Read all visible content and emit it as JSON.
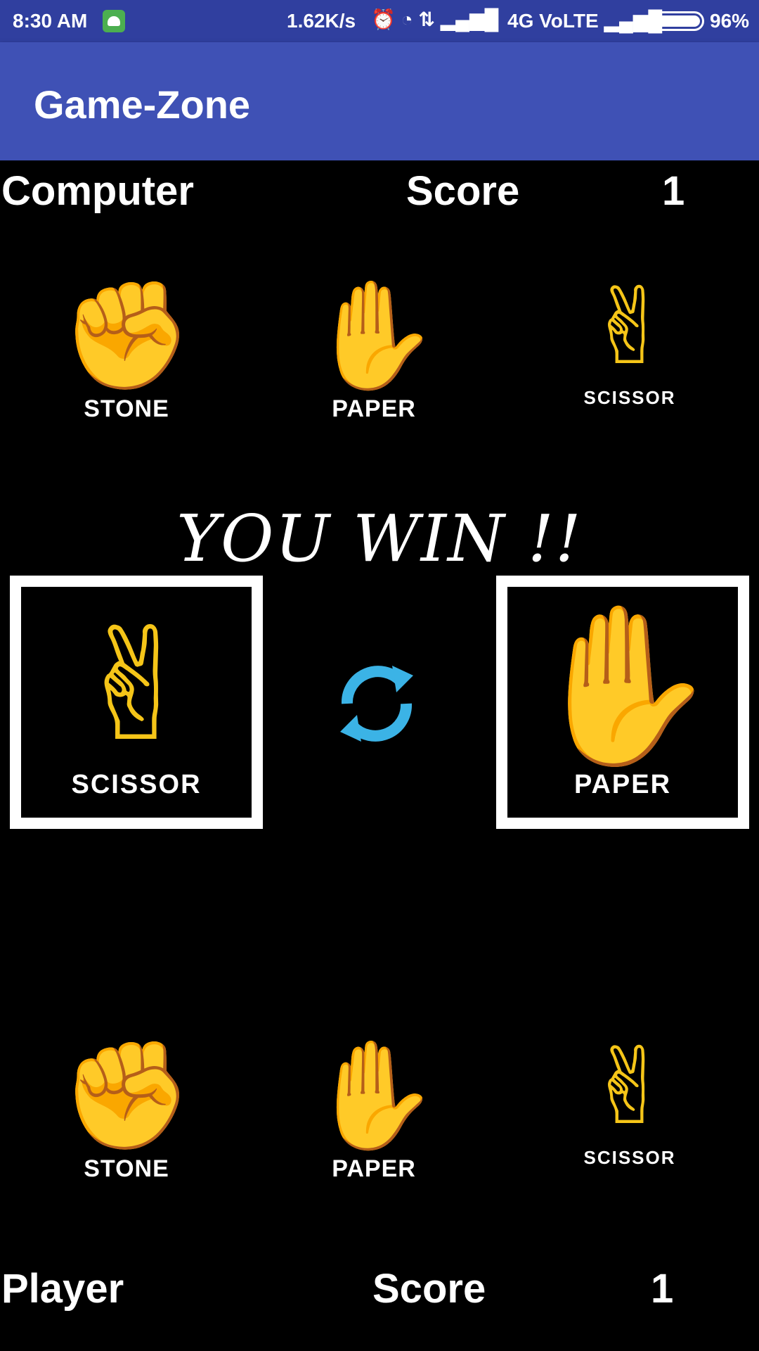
{
  "status_bar": {
    "time": "8:30 AM",
    "speed": "1.62K/s",
    "icons": "⏰ ◔ ⇅ ▂▄▆█",
    "network": "4G VoLTE ▂▄▆█",
    "battery_pct": "96%",
    "battery_level": 0.96,
    "notification_icon": "android-icon"
  },
  "app_bar": {
    "title": "Game-Zone"
  },
  "computer": {
    "label": "Computer",
    "score_label": "Score",
    "score": "1",
    "choices": [
      {
        "glyph": "✊",
        "label": "STONE"
      },
      {
        "glyph": "✋",
        "label": "PAPER"
      },
      {
        "glyph": "✌",
        "label": "SCISSOR"
      }
    ]
  },
  "result": {
    "text": "YOU WIN !!"
  },
  "battle": {
    "computer_pick": {
      "glyph": "✌",
      "label": "SCISSOR"
    },
    "player_pick": {
      "glyph": "✋",
      "label": "PAPER"
    },
    "refresh_icon": "refresh-icon",
    "refresh_color": "#3BB3E6"
  },
  "player": {
    "label": "Player",
    "score_label": "Score",
    "score": "1",
    "choices": [
      {
        "glyph": "✊",
        "label": "STONE"
      },
      {
        "glyph": "✋",
        "label": "PAPER"
      },
      {
        "glyph": "✌",
        "label": "SCISSOR"
      }
    ]
  },
  "colors": {
    "status_bar": "#303F9F",
    "app_bar": "#3F51B5",
    "background": "#000000",
    "hand": "#F5C518"
  }
}
